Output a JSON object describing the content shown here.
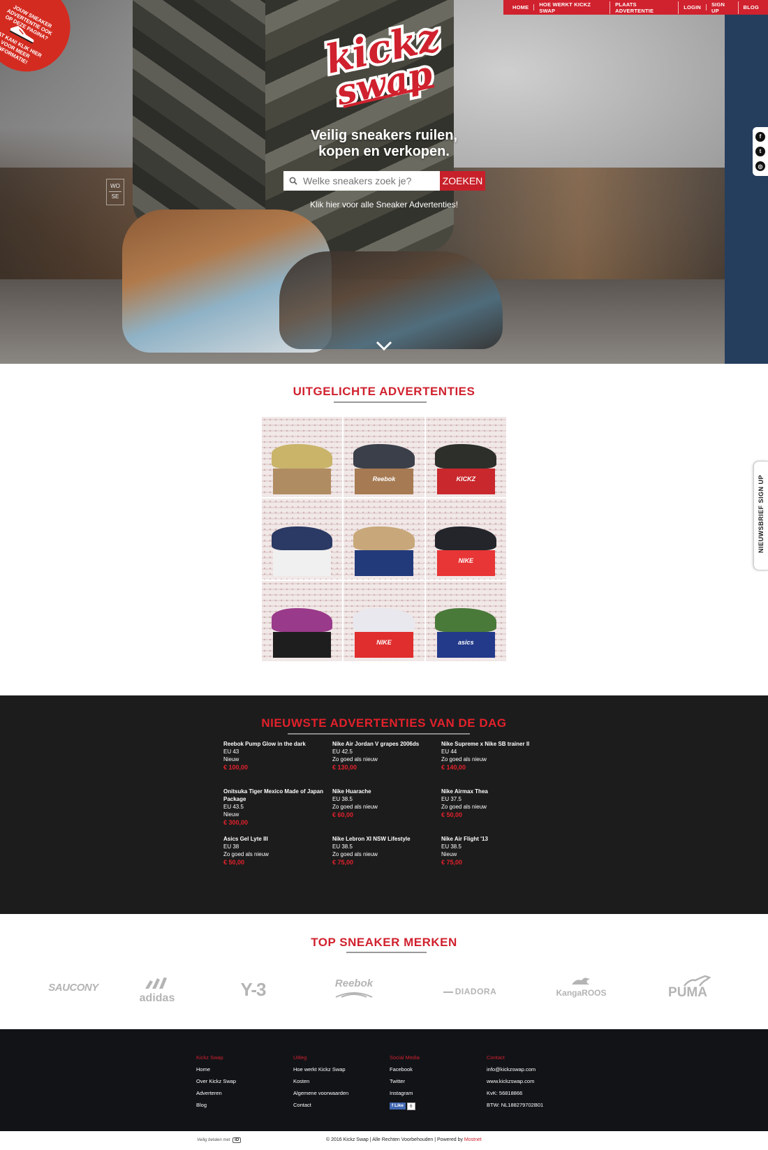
{
  "nav": {
    "items": [
      "HOME",
      "HOE WERKT KICKZ SWAP",
      "PLAATS ADVERTENTIE",
      "LOGIN",
      "SIGN UP",
      "BLOG"
    ]
  },
  "badge": {
    "line1": "JOUW SNEAKER ADVERTENTIE OOK OP DEZE PAGINA?",
    "line2": "DAT KAN! KLIK HIER VOOR MEER INFORMATIE!"
  },
  "logo": {
    "line1": "kickz",
    "line2": "swap"
  },
  "hero": {
    "tagline_line1": "Veilig sneakers ruilen,",
    "tagline_line2": "kopen en verkopen.",
    "search_placeholder": "Welke sneakers zoek je?",
    "search_button": "ZOEKEN",
    "all_ads_link": "Klik hier voor alle Sneaker Advertenties!",
    "watermark_top": "WO",
    "watermark_bottom": "SE"
  },
  "social_sidebar": {
    "icons": [
      "facebook-icon",
      "twitter-icon",
      "instagram-icon"
    ]
  },
  "newsletter_tab": "NIEUWSBRIEF SIGN UP",
  "featured": {
    "title": "UITGELICHTE ADVERTENTIES",
    "tiles": [
      {
        "shoe": "#c9b46a",
        "box": "#b08c62",
        "box_label": ""
      },
      {
        "shoe": "#3b3f4a",
        "box": "#a67a52",
        "box_label": "Reebok"
      },
      {
        "shoe": "#2c2f2a",
        "box": "#c9282c",
        "box_label": "KICKZ"
      },
      {
        "shoe": "#2b3a64",
        "box": "#f0f0f0",
        "box_label": ""
      },
      {
        "shoe": "#c8a87a",
        "box": "#233a7a",
        "box_label": ""
      },
      {
        "shoe": "#23252b",
        "box": "#e83535",
        "box_label": "NIKE"
      },
      {
        "shoe": "#9a3a8a",
        "box": "#1e1e1e",
        "box_label": ""
      },
      {
        "shoe": "#e8e8ee",
        "box": "#e02d2d",
        "box_label": "NIKE"
      },
      {
        "shoe": "#4a7a3a",
        "box": "#233a8a",
        "box_label": "asics"
      }
    ]
  },
  "newest": {
    "title": "NIEUWSTE ADVERTENTIES VAN DE DAG",
    "ads": [
      {
        "name": "Reebok Pump Glow in the dark",
        "size": "EU 43",
        "condition": "Nieuw",
        "price": "€ 100,00"
      },
      {
        "name": "Nike Air Jordan V grapes 2006ds",
        "size": "EU 42.5",
        "condition": "Zo goed als nieuw",
        "price": "€ 130,00"
      },
      {
        "name": "Nike Supreme x Nike SB trainer ll",
        "size": "EU 44",
        "condition": "Zo goed als nieuw",
        "price": "€ 140,00"
      },
      {
        "name": "Onitsuka Tiger Mexico Made of Japan Package",
        "size": "EU 43.5",
        "condition": "Nieuw",
        "price": "€ 300,00"
      },
      {
        "name": "Nike Huarache",
        "size": "EU 38.5",
        "condition": "Zo goed als nieuw",
        "price": "€ 60,00"
      },
      {
        "name": "Nike Airmax Thea",
        "size": "EU 37.5",
        "condition": "Zo goed als nieuw",
        "price": "€ 50,00"
      },
      {
        "name": "Asics Gel Lyte III",
        "size": "EU 38",
        "condition": "Zo goed als nieuw",
        "price": "€ 50,00"
      },
      {
        "name": "Nike Lebron XI NSW Lifestyle",
        "size": "EU 38.5",
        "condition": "Zo goed als nieuw",
        "price": "€ 75,00"
      },
      {
        "name": "Nike Air Flight '13",
        "size": "EU 38.5",
        "condition": "Nieuw",
        "price": "€ 75,00"
      }
    ]
  },
  "brands": {
    "title": "TOP SNEAKER MERKEN",
    "items": [
      "SAUCONY",
      "adidas",
      "Y-3",
      "Reebok",
      "DIADORA",
      "KangaROOS",
      "PUMA"
    ]
  },
  "footer": {
    "columns": [
      {
        "heading": "Kickz Swap",
        "links": [
          "Home",
          "Over Kickz Swap",
          "Adverteren",
          "Blog"
        ]
      },
      {
        "heading": "Uitleg",
        "links": [
          "Hoe werkt Kickz Swap",
          "Kosten",
          "Algemene voorwaarden",
          "Contact"
        ]
      },
      {
        "heading": "Social Media",
        "links": [
          "Facebook",
          "Twitter",
          "Instagram"
        ]
      },
      {
        "heading": "Contact",
        "links": [
          "info@kickzswap.com",
          "www.kickzswap.com",
          "KvK: 56818866",
          "BTW: NL188279702B01"
        ]
      }
    ],
    "fb_like": "Like",
    "fb_count": "6",
    "pay_text": "Veilig betalen met",
    "pay_logo": "iD",
    "copyright": "© 2016 Kickz Swap | Alle Rechten Voorbehouden | Powered by ",
    "powered_by": "Mostnet"
  },
  "colors": {
    "accent": "#d0212e",
    "dark_bg": "#1c1c1c",
    "footer_bg": "#121317",
    "sidebar": "#253e5e"
  }
}
